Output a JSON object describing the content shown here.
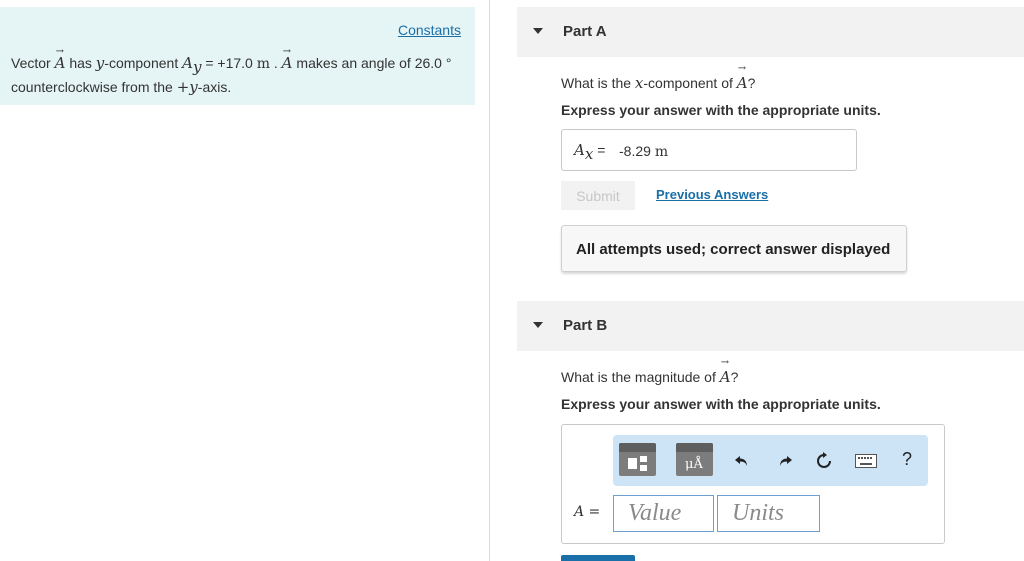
{
  "problem": {
    "constants_link": "Constants",
    "text_1": "Vector ",
    "vec_symbol": "A",
    "text_2": " has ",
    "y_var": "y",
    "text_3": "-component ",
    "ay_sym": "A",
    "ay_sub": "y",
    "text_4": " = +17.0 ",
    "unit_m": "m",
    "text_5": " . ",
    "vec_symbol_2": "A",
    "text_6": " makes an angle of 26.0 °",
    "line_2a": "counterclockwise from the ",
    "plus_y": "+y",
    "line_2b": "-axis."
  },
  "part_a": {
    "title": "Part A",
    "question_pre": "What is the ",
    "question_var": "x",
    "question_mid": "-component of ",
    "question_vec": "A",
    "question_end": "?",
    "instruction": "Express your answer with the appropriate units.",
    "answer_lhs_sym": "A",
    "answer_lhs_sub": "x",
    "answer_lhs_eq": " = ",
    "answer_value": "-8.29",
    "answer_unit": "m",
    "submit_label": "Submit",
    "previous_answers": "Previous Answers",
    "feedback": "All attempts used; correct answer displayed"
  },
  "part_b": {
    "title": "Part B",
    "question_pre": "What is the magnitude of ",
    "question_vec": "A",
    "question_end": "?",
    "instruction": "Express your answer with the appropriate units.",
    "answer_lhs": "A =",
    "value_placeholder": "Value",
    "units_placeholder": "Units",
    "units_button_glyph": "μÅ",
    "help_glyph": "?"
  },
  "colors": {
    "problem_bg": "#e5f4f5",
    "link": "#1a6fa8",
    "toolbar_bg": "#cde4f7",
    "part_header_bg": "#f2f2f2"
  },
  "icons": [
    "templates-icon",
    "units-icon",
    "undo-icon",
    "redo-icon",
    "reset-icon",
    "keyboard-icon",
    "help-icon"
  ]
}
